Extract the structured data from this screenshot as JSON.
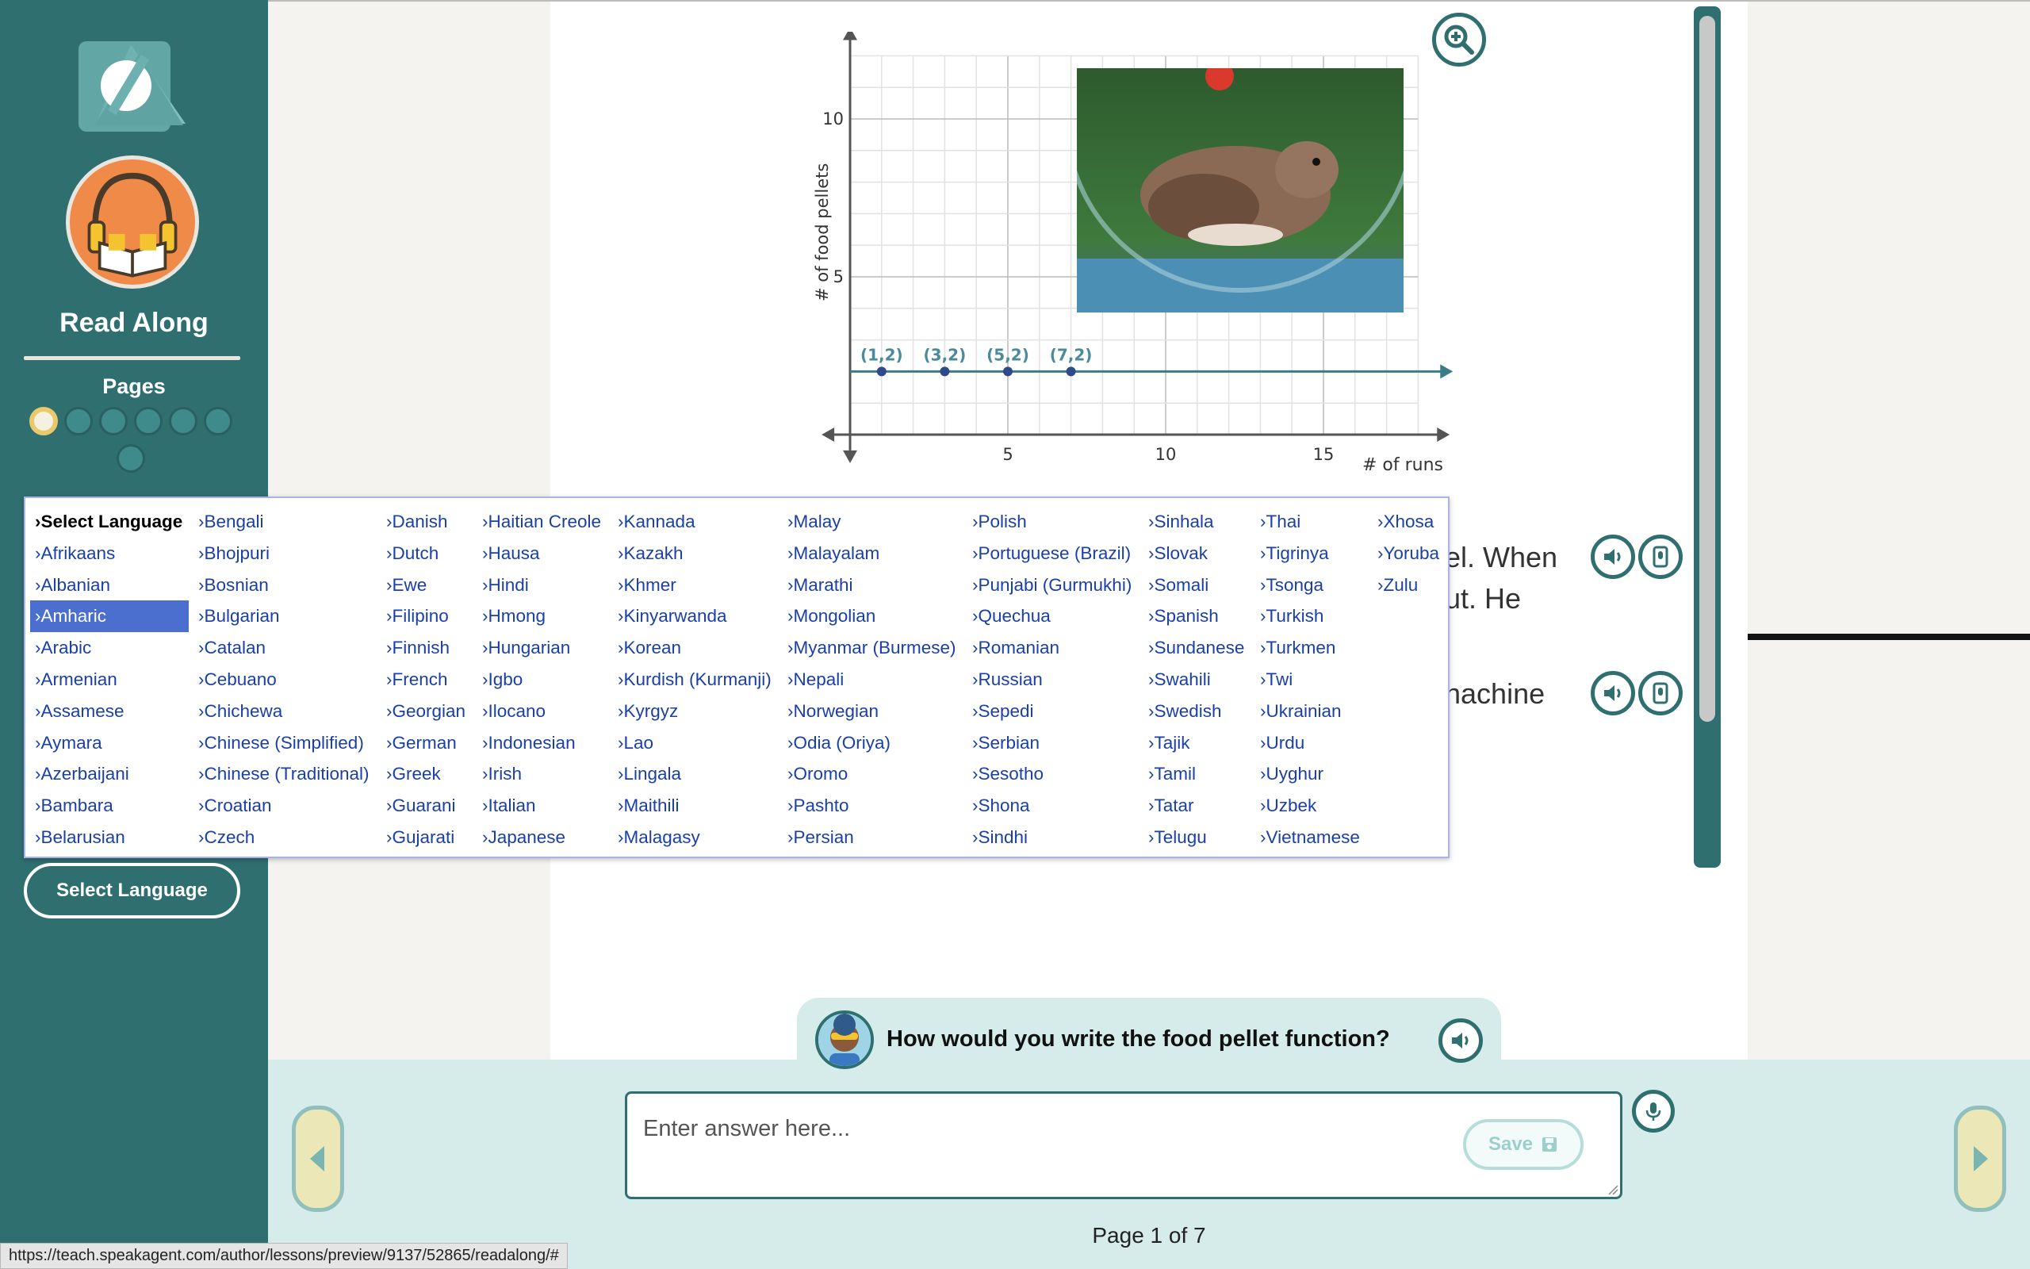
{
  "sidebar": {
    "title": "Read Along",
    "pages_label": "Pages",
    "language_button": "Select Language"
  },
  "chart_data": {
    "type": "scatter",
    "xlabel": "# of runs",
    "ylabel": "# of food pellets",
    "x_ticks": [
      5,
      10,
      15
    ],
    "y_ticks": [
      5,
      10
    ],
    "xlim": [
      0,
      18
    ],
    "ylim": [
      0,
      12
    ],
    "grid": true,
    "points": [
      {
        "x": 1,
        "y": 2,
        "label": "(1,2)"
      },
      {
        "x": 3,
        "y": 2,
        "label": "(3,2)"
      },
      {
        "x": 5,
        "y": 2,
        "label": "(5,2)"
      },
      {
        "x": 7,
        "y": 2,
        "label": "(7,2)"
      }
    ]
  },
  "reading": {
    "line1_tail": "el. When",
    "line2_tail": "ut. He",
    "line3_tail": "nachine"
  },
  "language_menu": {
    "columns": [
      [
        "Select Language",
        "›Afrikaans",
        "›Albanian",
        "›Amharic",
        "›Arabic",
        "›Armenian",
        "›Assamese",
        "›Aymara",
        "›Azerbaijani",
        "›Bambara",
        "›Belarusian"
      ],
      [
        "›Bengali",
        "›Bhojpuri",
        "›Bosnian",
        "›Bulgarian",
        "›Catalan",
        "›Cebuano",
        "›Chichewa",
        "›Chinese (Simplified)",
        "›Chinese (Traditional)",
        "›Croatian",
        "›Czech"
      ],
      [
        "›Danish",
        "›Dutch",
        "›Ewe",
        "›Filipino",
        "›Finnish",
        "›French",
        "›Georgian",
        "›German",
        "›Greek",
        "›Guarani",
        "›Gujarati"
      ],
      [
        "›Haitian Creole",
        "›Hausa",
        "›Hindi",
        "›Hmong",
        "›Hungarian",
        "›Igbo",
        "›Ilocano",
        "›Indonesian",
        "›Irish",
        "›Italian",
        "›Japanese"
      ],
      [
        "›Kannada",
        "›Kazakh",
        "›Khmer",
        "›Kinyarwanda",
        "›Korean",
        "›Kurdish (Kurmanji)",
        "›Kyrgyz",
        "›Lao",
        "›Lingala",
        "›Maithili",
        "›Malagasy"
      ],
      [
        "›Malay",
        "›Malayalam",
        "›Marathi",
        "›Mongolian",
        "›Myanmar (Burmese)",
        "›Nepali",
        "›Norwegian",
        "›Odia (Oriya)",
        "›Oromo",
        "›Pashto",
        "›Persian"
      ],
      [
        "›Polish",
        "›Portuguese (Brazil)",
        "›Punjabi (Gurmukhi)",
        "›Quechua",
        "›Romanian",
        "›Russian",
        "›Sepedi",
        "›Serbian",
        "›Sesotho",
        "›Shona",
        "›Sindhi"
      ],
      [
        "›Sinhala",
        "›Slovak",
        "›Somali",
        "›Spanish",
        "›Sundanese",
        "›Swahili",
        "›Swedish",
        "›Tajik",
        "›Tamil",
        "›Tatar",
        "›Telugu"
      ],
      [
        "›Thai",
        "›Tigrinya",
        "›Tsonga",
        "›Turkish",
        "›Turkmen",
        "›Twi",
        "›Ukrainian",
        "›Urdu",
        "›Uyghur",
        "›Uzbek",
        "›Vietnamese"
      ],
      [
        "›Xhosa",
        "›Yoruba",
        "›Zulu"
      ]
    ],
    "selected": "›Amharic"
  },
  "question": {
    "text": "How would you write the food pellet function?"
  },
  "answer": {
    "placeholder": "Enter answer here...",
    "save_label": "Save"
  },
  "pagination": {
    "indicator": "Page 1 of 7"
  },
  "status_bar": {
    "url": "https://teach.speakagent.com/author/lessons/preview/9137/52865/readalong/#"
  },
  "colors": {
    "teal": "#2f6f70",
    "selected": "#4a6fcf",
    "link": "#1a3fa8"
  }
}
